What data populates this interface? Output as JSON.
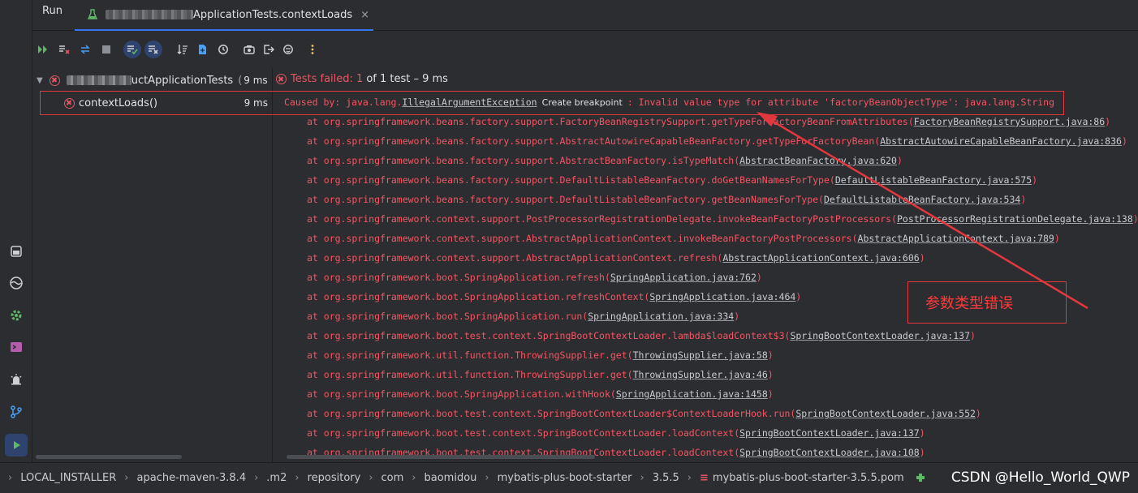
{
  "header": {
    "run_label": "Run",
    "tab_title": "ApplicationTests.contextLoads",
    "tab_close": "×"
  },
  "tree": {
    "root_label": "uctApplicationTests",
    "root_prefix": "(",
    "root_duration": "9 ms",
    "child_label": "contextLoads()",
    "child_duration": "9 ms"
  },
  "console": {
    "status_fail": "Tests failed: 1",
    "status_rest": "of 1 test – 9 ms",
    "caused_by_prefix": "Caused by: java.lang.",
    "caused_by_link": "IllegalArgumentException",
    "create_breakpoint": "Create breakpoint",
    "caused_by_message": ": Invalid value type for attribute 'factoryBeanObjectType': java.lang.String",
    "stack": [
      {
        "text": "at org.springframework.beans.factory.support.FactoryBeanRegistrySupport.getTypeForFactoryBeanFromAttributes(",
        "link": "FactoryBeanRegistrySupport.java:86",
        "end": ")"
      },
      {
        "text": "at org.springframework.beans.factory.support.AbstractAutowireCapableBeanFactory.getTypeForFactoryBean(",
        "link": "AbstractAutowireCapableBeanFactory.java:836",
        "end": ")"
      },
      {
        "text": "at org.springframework.beans.factory.support.AbstractBeanFactory.isTypeMatch(",
        "link": "AbstractBeanFactory.java:620",
        "end": ")"
      },
      {
        "text": "at org.springframework.beans.factory.support.DefaultListableBeanFactory.doGetBeanNamesForType(",
        "link": "DefaultListableBeanFactory.java:575",
        "end": ")"
      },
      {
        "text": "at org.springframework.beans.factory.support.DefaultListableBeanFactory.getBeanNamesForType(",
        "link": "DefaultListableBeanFactory.java:534",
        "end": ")"
      },
      {
        "text": "at org.springframework.context.support.PostProcessorRegistrationDelegate.invokeBeanFactoryPostProcessors(",
        "link": "PostProcessorRegistrationDelegate.java:138",
        "end": ")"
      },
      {
        "text": "at org.springframework.context.support.AbstractApplicationContext.invokeBeanFactoryPostProcessors(",
        "link": "AbstractApplicationContext.java:789",
        "end": ")"
      },
      {
        "text": "at org.springframework.context.support.AbstractApplicationContext.refresh(",
        "link": "AbstractApplicationContext.java:606",
        "end": ")"
      },
      {
        "text": "at org.springframework.boot.SpringApplication.refresh(",
        "link": "SpringApplication.java:762",
        "end": ")"
      },
      {
        "text": "at org.springframework.boot.SpringApplication.refreshContext(",
        "link": "SpringApplication.java:464",
        "end": ")"
      },
      {
        "text": "at org.springframework.boot.SpringApplication.run(",
        "link": "SpringApplication.java:334",
        "end": ")"
      },
      {
        "text": "at org.springframework.boot.test.context.SpringBootContextLoader.lambda$loadContext$3(",
        "link": "SpringBootContextLoader.java:137",
        "end": ")"
      },
      {
        "text": "at org.springframework.util.function.ThrowingSupplier.get(",
        "link": "ThrowingSupplier.java:58",
        "end": ")"
      },
      {
        "text": "at org.springframework.util.function.ThrowingSupplier.get(",
        "link": "ThrowingSupplier.java:46",
        "end": ")"
      },
      {
        "text": "at org.springframework.boot.SpringApplication.withHook(",
        "link": "SpringApplication.java:1458",
        "end": ")"
      },
      {
        "text": "at org.springframework.boot.test.context.SpringBootContextLoader$ContextLoaderHook.run(",
        "link": "SpringBootContextLoader.java:552",
        "end": ")"
      },
      {
        "text": "at org.springframework.boot.test.context.SpringBootContextLoader.loadContext(",
        "link": "SpringBootContextLoader.java:137",
        "end": ")"
      },
      {
        "text": "at org.springframework.boot.test.context.SpringBootContextLoader.loadContext(",
        "link": "SpringBootContextLoader.java:108",
        "end": ")"
      }
    ]
  },
  "annotation": {
    "text": "参数类型错误"
  },
  "breadcrumb": {
    "items": [
      "LOCAL_INSTALLER",
      "apache-maven-3.8.4",
      ".m2",
      "repository",
      "com",
      "baomidou",
      "mybatis-plus-boot-starter",
      "3.5.5",
      "mybatis-plus-boot-starter-3.5.5.pom"
    ],
    "watermark": "CSDN @Hello_World_QWP"
  },
  "colors": {
    "accent": "#3574f0",
    "error": "#e55765",
    "stack_text": "#f75464",
    "annotation": "#e2383d"
  }
}
